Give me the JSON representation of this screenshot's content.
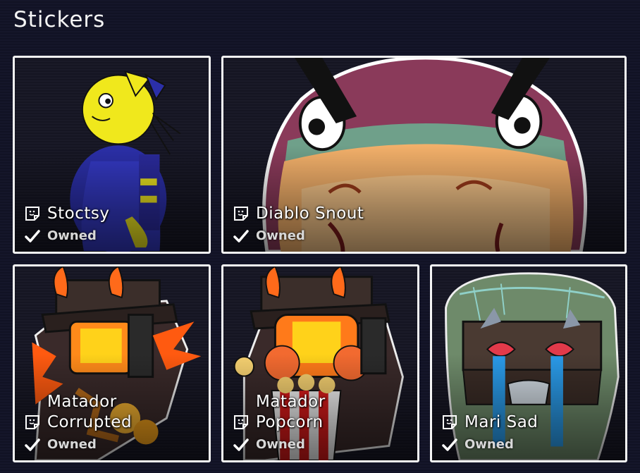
{
  "page": {
    "title": "Stickers"
  },
  "stickers": [
    {
      "name": "Stoctsy",
      "status": "Owned"
    },
    {
      "name": "Diablo Snout",
      "status": "Owned"
    },
    {
      "name": "Matador Corrupted",
      "status": "Owned"
    },
    {
      "name": "Matador Popcorn",
      "status": "Owned"
    },
    {
      "name": "Mari Sad",
      "status": "Owned"
    }
  ],
  "icons": {
    "sticker": "sticker-icon",
    "owned": "checkmark-icon"
  },
  "colors": {
    "card_border": "#f5f5f5",
    "background": "#13142a"
  }
}
